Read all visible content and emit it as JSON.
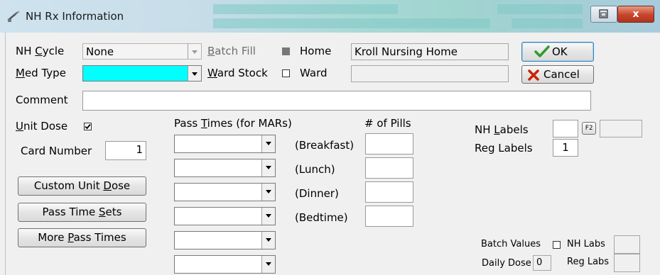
{
  "window": {
    "title": "NH Rx Information",
    "close_glyph": "x"
  },
  "form": {
    "nh_cycle_label_pre": "NH ",
    "nh_cycle_label_u": "C",
    "nh_cycle_label_post": "ycle",
    "nh_cycle_value": "None",
    "med_type_label_u": "M",
    "med_type_label_post": "ed Type",
    "batch_fill_label_u": "B",
    "batch_fill_label_post": "atch Fill",
    "ward_stock_label_u": "W",
    "ward_stock_label_post": "ard Stock",
    "home_label": "Home",
    "home_value": "Kroll Nursing Home",
    "ward_label": "Ward",
    "ward_value": "",
    "comment_label": "Comment",
    "comment_value": "",
    "unit_dose_label_u": "U",
    "unit_dose_label_post": "nit Dose",
    "unit_dose_checked": true,
    "card_number_label": "Card Number",
    "card_number_value": "1",
    "pass_times_label_pre": "Pass ",
    "pass_times_label_u": "T",
    "pass_times_label_post": "imes (for MARs)",
    "pills_header": "# of Pills",
    "meal_labels": [
      "(Breakfast)",
      "(Lunch)",
      "(Dinner)",
      "(Bedtime)"
    ],
    "nh_labels_label_pre": "NH ",
    "nh_labels_label_u": "L",
    "nh_labels_label_post": "abels",
    "nh_labels_value": "",
    "f2_label": "F2",
    "reg_labels_label": "Reg Labels",
    "reg_labels_value": "1",
    "batch_values_label": "Batch Values",
    "nh_labs_label": "NH Labs",
    "daily_dose_label": "Daily Dose",
    "daily_dose_value": "0",
    "reg_labs_label": "Reg Labs"
  },
  "buttons": {
    "ok": "OK",
    "cancel": "Cancel",
    "custom_unit_dose_pre": "Custom Unit ",
    "custom_unit_dose_u": "D",
    "custom_unit_dose_post": "ose",
    "pass_time_sets_pre": "Pass Time ",
    "pass_time_sets_u": "S",
    "pass_time_sets_post": "ets",
    "more_pass_times_pre": "More ",
    "more_pass_times_u": "P",
    "more_pass_times_post": "ass Times"
  },
  "colors": {
    "med_type_fill": "#00ffff",
    "ok_icon": "#2e9a2e",
    "cancel_icon": "#cc2200"
  },
  "icons": {
    "title": "pill-bottle-icon",
    "ok": "check-icon",
    "cancel": "x-icon"
  }
}
